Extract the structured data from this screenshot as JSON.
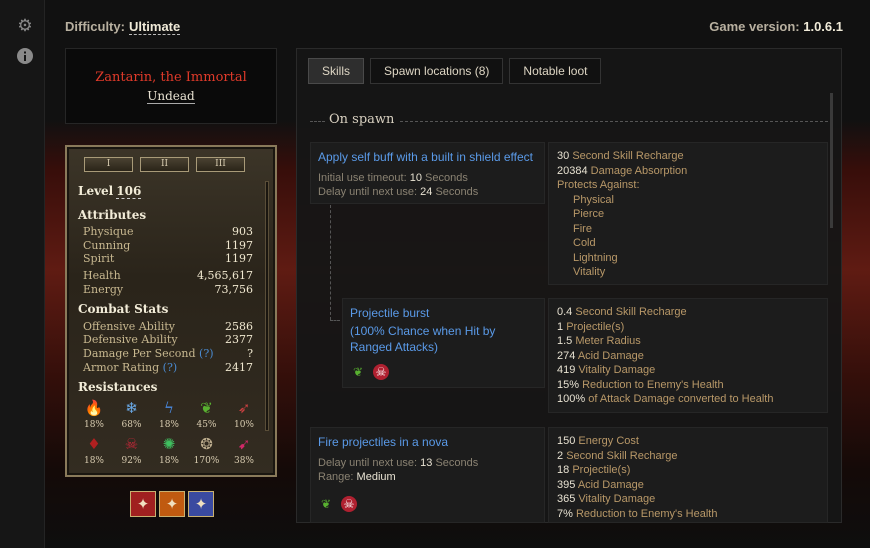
{
  "rail": {
    "settings_icon": "gear-icon",
    "info_icon": "info-icon"
  },
  "header": {
    "difficulty_label": "Difficulty:",
    "difficulty_value": "Ultimate",
    "version_label": "Game version:",
    "version_value": "1.0.6.1"
  },
  "monster": {
    "name": "Zantarin, the Immortal",
    "type": "Undead"
  },
  "sheet": {
    "tabs": [
      "I",
      "II",
      "III"
    ],
    "level_label": "Level",
    "level_value": "106",
    "attributes_label": "Attributes",
    "attributes": [
      {
        "name": "Physique",
        "value": "903"
      },
      {
        "name": "Cunning",
        "value": "1197"
      },
      {
        "name": "Spirit",
        "value": "1197"
      },
      {
        "name": "Health",
        "value": "4,565,617"
      },
      {
        "name": "Energy",
        "value": "73,756"
      }
    ],
    "combat_label": "Combat Stats",
    "combat": [
      {
        "name": "Offensive Ability",
        "value": "2586"
      },
      {
        "name": "Defensive Ability",
        "value": "2377"
      },
      {
        "name": "Damage Per Second",
        "help": "(?)",
        "value": "?"
      },
      {
        "name": "Armor Rating",
        "help": "(?)",
        "value": "2417"
      }
    ],
    "resistances_label": "Resistances",
    "resistances": [
      {
        "icon": "fire-icon",
        "pct": "18%",
        "color": "#d0601a"
      },
      {
        "icon": "cold-icon",
        "pct": "68%",
        "color": "#6aaae8"
      },
      {
        "icon": "lightning-icon",
        "pct": "18%",
        "color": "#4a8ae0"
      },
      {
        "icon": "poison-acid-icon",
        "pct": "45%",
        "color": "#58b030"
      },
      {
        "icon": "pierce-icon",
        "pct": "10%",
        "color": "#c84040"
      },
      {
        "icon": "bleeding-icon",
        "pct": "18%",
        "color": "#b02020"
      },
      {
        "icon": "vitality-icon",
        "pct": "92%",
        "color": "#c02838"
      },
      {
        "icon": "aether-icon",
        "pct": "18%",
        "color": "#40c060"
      },
      {
        "icon": "chaos-icon",
        "pct": "170%",
        "color": "#c0b090"
      },
      {
        "icon": "stun-icon",
        "pct": "38%",
        "color": "#d02868"
      }
    ],
    "devotions": [
      {
        "icon": "devotion-red-icon",
        "color": "#a02020"
      },
      {
        "icon": "devotion-orange-icon",
        "color": "#c05a10"
      },
      {
        "icon": "devotion-blue-icon",
        "color": "#3a4aa0"
      }
    ]
  },
  "panel": {
    "tabs": [
      "Skills",
      "Spawn locations (8)",
      "Notable loot"
    ],
    "section_title": "On spawn",
    "skills": [
      {
        "title": "Apply self buff with a built in shield effect",
        "lines": [
          {
            "label": "Initial use timeout:",
            "value": "10",
            "unit": "Seconds"
          },
          {
            "label": "Delay until next use:",
            "value": "24",
            "unit": "Seconds"
          }
        ],
        "stats": [
          {
            "v": "30",
            "t": "Second Skill Recharge"
          },
          {
            "v": "20384",
            "t": "Damage Absorption"
          },
          {
            "v": "",
            "t": "Protects Against:"
          },
          {
            "v": "",
            "t": "Physical",
            "indent": true
          },
          {
            "v": "",
            "t": "Pierce",
            "indent": true
          },
          {
            "v": "",
            "t": "Fire",
            "indent": true
          },
          {
            "v": "",
            "t": "Cold",
            "indent": true
          },
          {
            "v": "",
            "t": "Lightning",
            "indent": true
          },
          {
            "v": "",
            "t": "Vitality",
            "indent": true
          }
        ]
      },
      {
        "title": "Projectile burst",
        "subtitle": "(100% Chance when Hit by Ranged Attacks)",
        "icons": [
          "acid-icon",
          "vitality-skull-icon"
        ],
        "stats": [
          {
            "v": "0.4",
            "t": "Second Skill Recharge"
          },
          {
            "v": "1",
            "t": "Projectile(s)"
          },
          {
            "v": "1.5",
            "t": "Meter Radius"
          },
          {
            "v": "274",
            "t": "Acid Damage"
          },
          {
            "v": "419",
            "t": "Vitality Damage"
          },
          {
            "v": "15%",
            "t": "Reduction to Enemy's Health"
          },
          {
            "v": "100%",
            "t": "of Attack Damage converted to Health"
          }
        ]
      },
      {
        "title": "Fire projectiles in a nova",
        "lines": [
          {
            "label": "Delay until next use:",
            "value": "13",
            "unit": "Seconds"
          },
          {
            "label": "Range:",
            "value": "Medium",
            "unit": ""
          }
        ],
        "icons": [
          "acid-icon",
          "vitality-skull-icon"
        ],
        "stats": [
          {
            "v": "150",
            "t": "Energy Cost"
          },
          {
            "v": "2",
            "t": "Second Skill Recharge"
          },
          {
            "v": "18",
            "t": "Projectile(s)"
          },
          {
            "v": "395",
            "t": "Acid Damage"
          },
          {
            "v": "365",
            "t": "Vitality Damage"
          },
          {
            "v": "7%",
            "t": "Reduction to Enemy's Health"
          }
        ]
      }
    ]
  }
}
